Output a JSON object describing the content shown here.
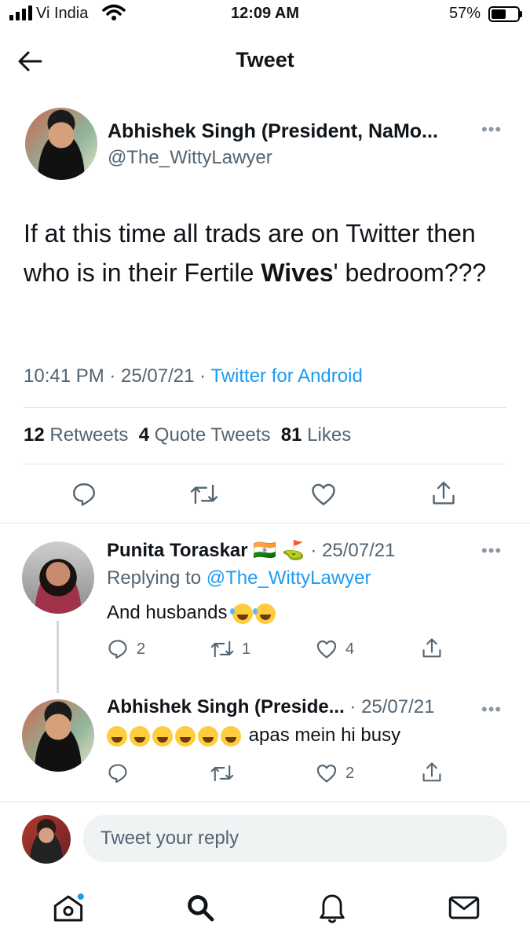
{
  "status_bar": {
    "carrier": "Vi India",
    "time": "12:09 AM",
    "battery": "57%"
  },
  "header": {
    "title": "Tweet"
  },
  "tweet": {
    "display_name": "Abhishek Singh (President, NaMo...",
    "handle": "@The_WittyLawyer",
    "text_part1": "If at this time all trads are on Twitter then who is in their Fertile ",
    "text_bold": "Wives",
    "text_part2": "' bedroom???",
    "timestamp": "10:41 PM · 25/07/21 ·",
    "source": "Twitter for Android",
    "stats": {
      "retweets_count": "12",
      "retweets_label": "Retweets",
      "quotes_count": "4",
      "quotes_label": "Quote Tweets",
      "likes_count": "81",
      "likes_label": "Likes"
    }
  },
  "replies": [
    {
      "display_name": "Punita Toraskar",
      "flags": "🇮🇳 ⛳",
      "date": "· 25/07/21",
      "replying_prefix": "Replying to",
      "replying_handle": "@The_WittyLawyer",
      "text": "And husbands",
      "reply_count": "2",
      "retweet_count": "1",
      "like_count": "4"
    },
    {
      "display_name": "Abhishek Singh (Preside...",
      "date": "· 25/07/21",
      "text": "apas mein hi busy",
      "reply_count": "",
      "retweet_count": "",
      "like_count": "2"
    }
  ],
  "compose": {
    "placeholder": "Tweet your reply"
  },
  "icons": [
    "back-arrow-icon",
    "wifi-icon",
    "battery-icon",
    "more-icon",
    "reply-icon",
    "retweet-icon",
    "like-icon",
    "share-icon",
    "home-icon",
    "search-icon",
    "notifications-icon",
    "messages-icon"
  ],
  "colors": {
    "accent": "#1d9bf0",
    "muted": "#536471",
    "text": "#0f1419"
  }
}
